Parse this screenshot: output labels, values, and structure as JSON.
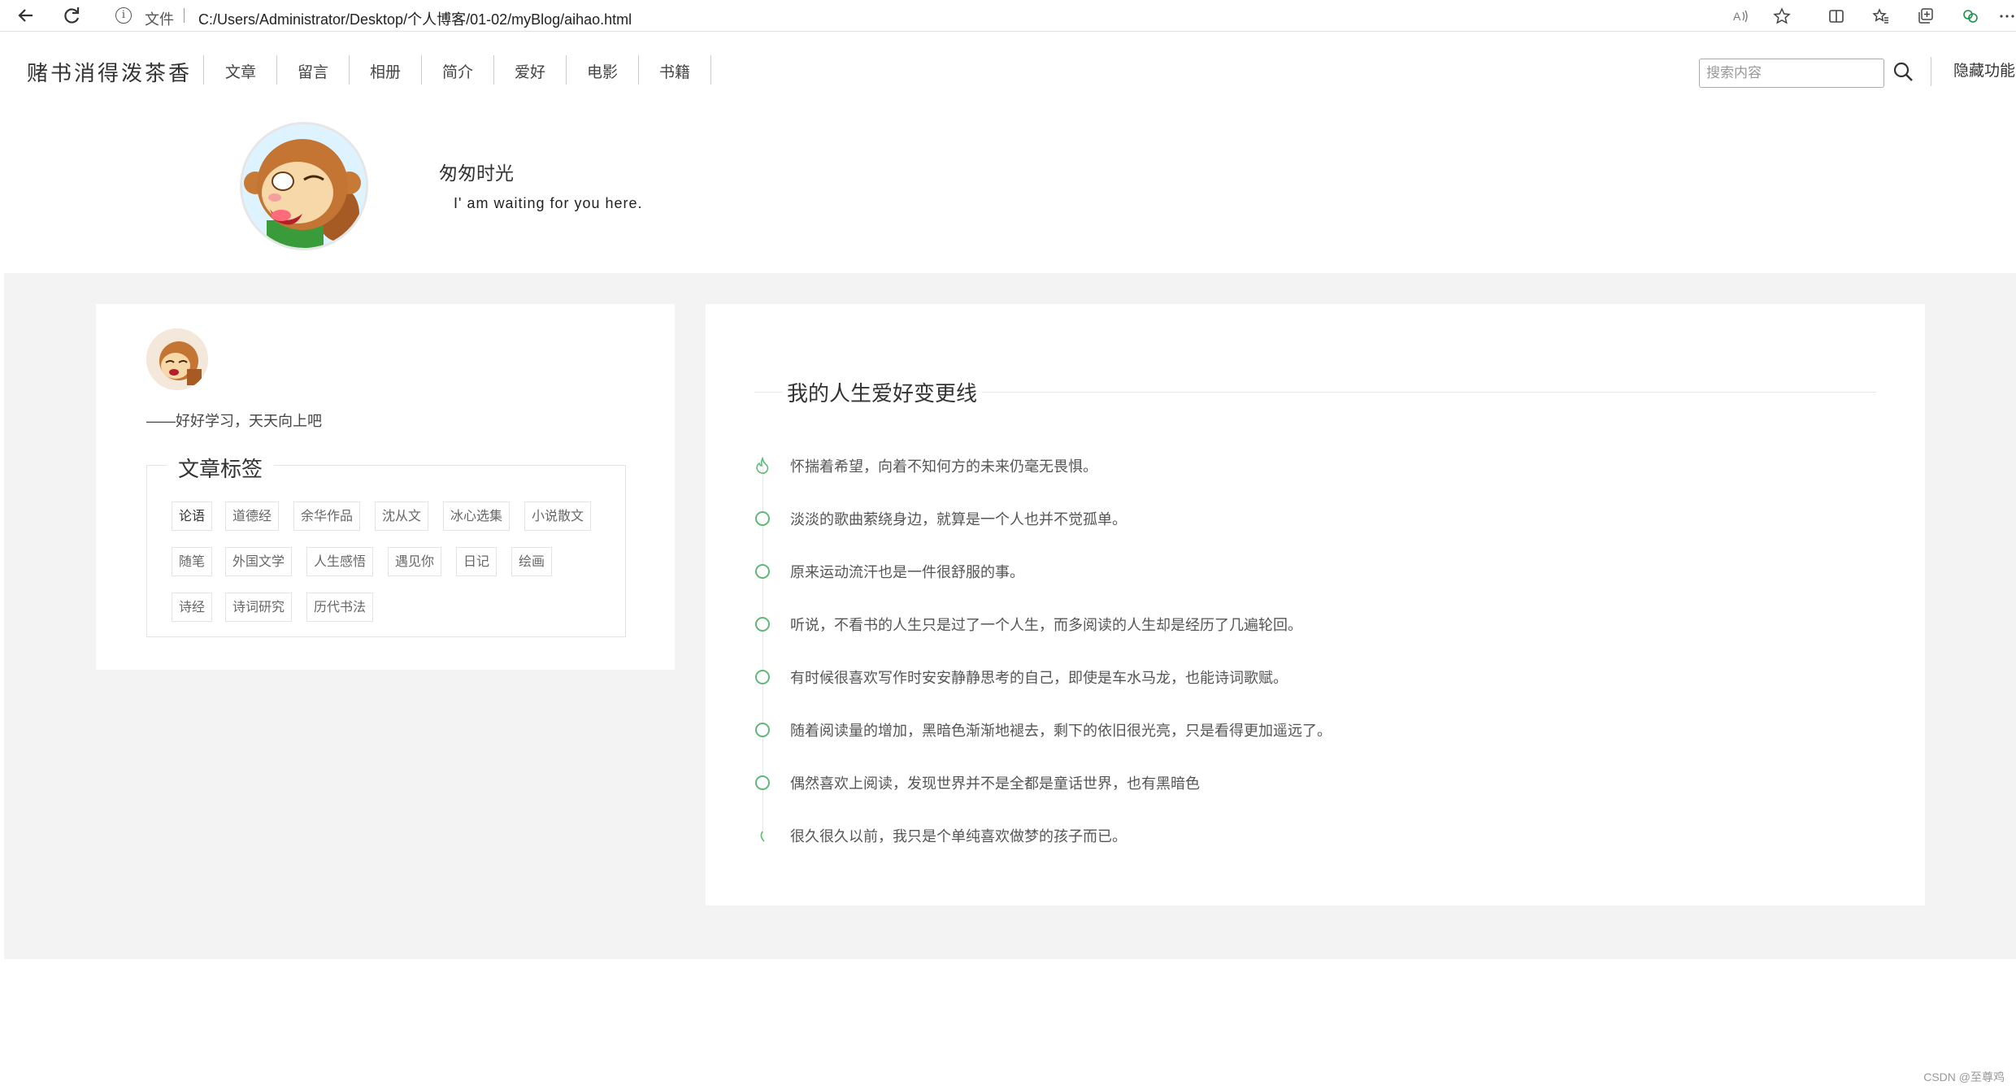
{
  "browser": {
    "file_label": "文件",
    "url": "C:/Users/Administrator/Desktop/个人博客/01-02/myBlog/aihao.html"
  },
  "nav": {
    "brand": "赌书消得泼茶香",
    "items": [
      "文章",
      "留言",
      "相册",
      "简介",
      "爱好",
      "电影",
      "书籍"
    ],
    "search_placeholder": "搜索内容",
    "hide_label": "隐藏功能"
  },
  "profile": {
    "name": "匆匆时光",
    "motto": "I' am waiting for you here."
  },
  "sidebar": {
    "signature": "——好好学习，天天向上吧",
    "tags_title": "文章标签",
    "tags": [
      "论语",
      "道德经",
      "余华作品",
      "沈从文",
      "冰心选集",
      "小说散文",
      "随笔",
      "外国文学",
      "人生感悟",
      "遇见你",
      "日记",
      "绘画",
      "诗经",
      "诗词研究",
      "历代书法"
    ]
  },
  "timeline": {
    "title": "我的人生爱好变更线",
    "items": [
      "怀揣着希望，向着不知何方的未来仍毫无畏惧。",
      "淡淡的歌曲萦绕身边，就算是一个人也并不觉孤单。",
      "原来运动流汗也是一件很舒服的事。",
      "听说，不看书的人生只是过了一个人生，而多阅读的人生却是经历了几遍轮回。",
      "有时候很喜欢写作时安安静静思考的自己，即使是车水马龙，也能诗词歌赋。",
      "随着阅读量的增加，黑暗色渐渐地褪去，剩下的依旧很光亮，只是看得更加遥远了。",
      "偶然喜欢上阅读，发现世界并不是全都是童话世界，也有黑暗色",
      "很久很久以前，我只是个单纯喜欢做梦的孩子而已。"
    ]
  },
  "watermark": "CSDN @至尊鸡",
  "colors": {
    "accent": "#5fb878",
    "background": "#f3f3f3"
  },
  "icons": [
    "back-arrow-icon",
    "refresh-icon",
    "info-icon",
    "read-aloud-icon",
    "favorite-star-icon",
    "split-screen-icon",
    "favorites-icon",
    "collections-icon",
    "extension-icon",
    "more-icon",
    "search-icon",
    "flame-icon",
    "circle-icon"
  ]
}
